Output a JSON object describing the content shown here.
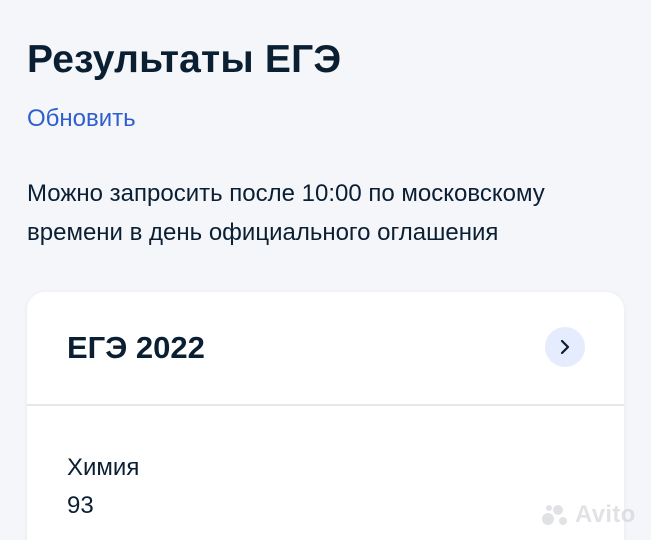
{
  "header": {
    "title": "Результаты ЕГЭ",
    "refresh_label": "Обновить"
  },
  "info": {
    "text": "Можно запросить после 10:00 по московскому времени в день официального оглашения"
  },
  "card": {
    "title": "ЕГЭ 2022",
    "chevron_icon": "chevron-right-icon",
    "subjects": [
      {
        "name": "Химия",
        "score": "93"
      }
    ]
  },
  "watermark": {
    "text": "Avito"
  },
  "colors": {
    "background": "#f5f6fa",
    "link": "#2f5fcf",
    "text": "#0b1f33",
    "chevron_bg": "#e4ecfd",
    "card_bg": "#ffffff"
  }
}
